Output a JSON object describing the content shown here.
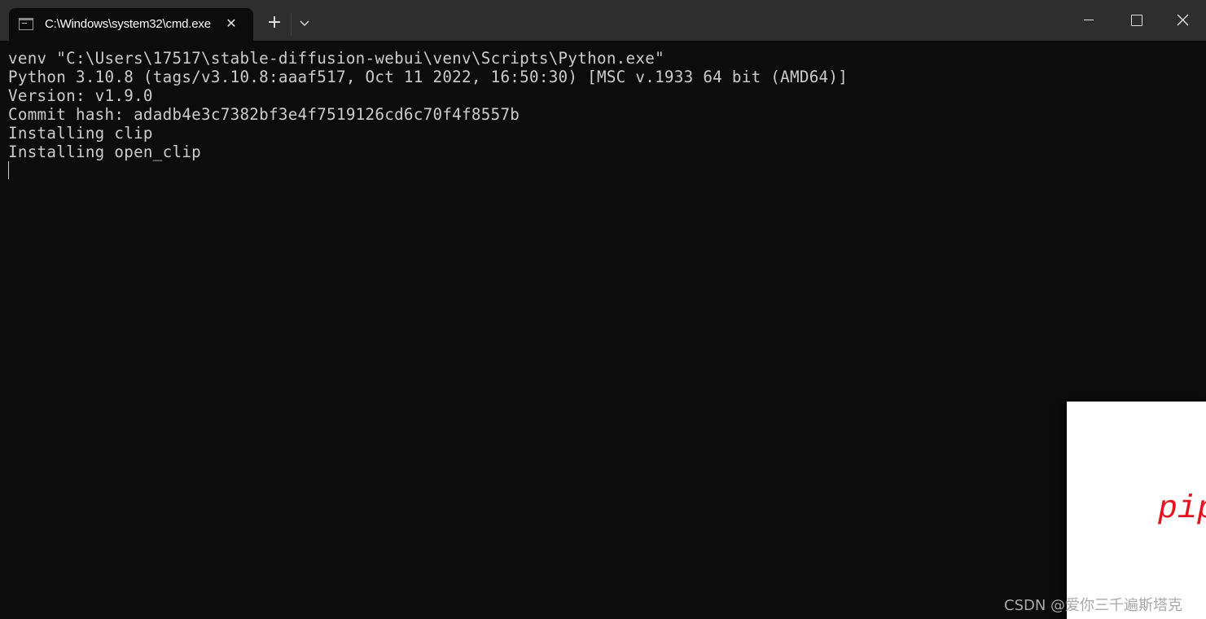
{
  "window": {
    "tab_title": "C:\\Windows\\system32\\cmd.exe",
    "tab_icon": "console-icon",
    "tab_close_glyph": "✕",
    "new_tab_glyph": "+",
    "controls": [
      "minimize",
      "maximize",
      "close"
    ]
  },
  "terminal": {
    "lines": [
      "venv \"C:\\Users\\17517\\stable-diffusion-webui\\venv\\Scripts\\Python.exe\"",
      "Python 3.10.8 (tags/v3.10.8:aaaf517, Oct 11 2022, 16:50:30) [MSC v.1933 64 bit (AMD64)]",
      "Version: v1.9.0",
      "Commit hash: adadb4e3c7382bf3e4f7519126cd6c70f4f8557b",
      "Installing clip",
      "Installing open_clip"
    ],
    "text_color": "#cccccc",
    "background": "#0c0c0c"
  },
  "overlay": {
    "text": "pip",
    "text_color": "#e3141f"
  },
  "watermark": {
    "text": "CSDN @爱你三千遍斯塔克"
  }
}
